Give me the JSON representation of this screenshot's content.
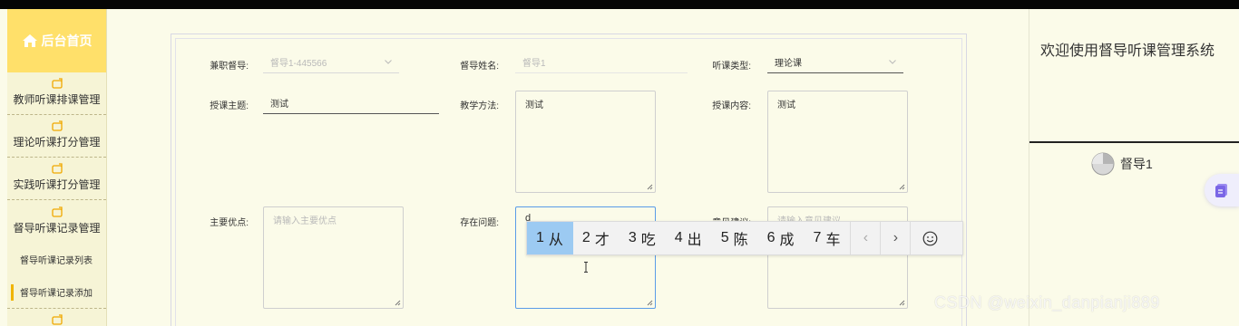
{
  "sidebar": {
    "home_label": "后台首页",
    "menu": [
      {
        "label": "教师听课排课管理"
      },
      {
        "label": "理论听课打分管理"
      },
      {
        "label": "实践听课打分管理"
      },
      {
        "label": "督导听课记录管理"
      }
    ],
    "sub_items": [
      {
        "label": "督导听课记录列表",
        "active": false
      },
      {
        "label": "督导听课记录添加",
        "active": true
      }
    ],
    "accent_color": "#ffe06a"
  },
  "form": {
    "supervisor_id": {
      "label": "兼职督导:",
      "value": "督导1-445566"
    },
    "supervisor_name": {
      "label": "督导姓名:",
      "value": "督导1"
    },
    "lecture_type": {
      "label": "听课类型:",
      "value": "理论课"
    },
    "topic": {
      "label": "授课主题:",
      "value": "测试"
    },
    "method": {
      "label": "教学方法:",
      "value": "测试"
    },
    "content": {
      "label": "授课内容:",
      "value": "测试"
    },
    "strengths": {
      "label": "主要优点:",
      "placeholder": "请输入主要优点"
    },
    "problems": {
      "label": "存在问题:",
      "value": "d"
    },
    "suggestions": {
      "label": "意见建议:",
      "placeholder": "请输入意见建议"
    }
  },
  "ime": {
    "candidates": [
      {
        "num": "1",
        "text": "从",
        "selected": true
      },
      {
        "num": "2",
        "text": "才",
        "selected": false
      },
      {
        "num": "3",
        "text": "吃",
        "selected": false
      },
      {
        "num": "4",
        "text": "出",
        "selected": false
      },
      {
        "num": "5",
        "text": "陈",
        "selected": false
      },
      {
        "num": "6",
        "text": "成",
        "selected": false
      },
      {
        "num": "7",
        "text": "车",
        "selected": false
      }
    ],
    "prev_glyph": "‹",
    "next_glyph": "›",
    "emoji_icon": "smiley-icon"
  },
  "right_panel": {
    "welcome": "欢迎使用督导听课管理系统",
    "username": "督导1"
  },
  "watermark": "CSDN @weixin_danpianji889"
}
